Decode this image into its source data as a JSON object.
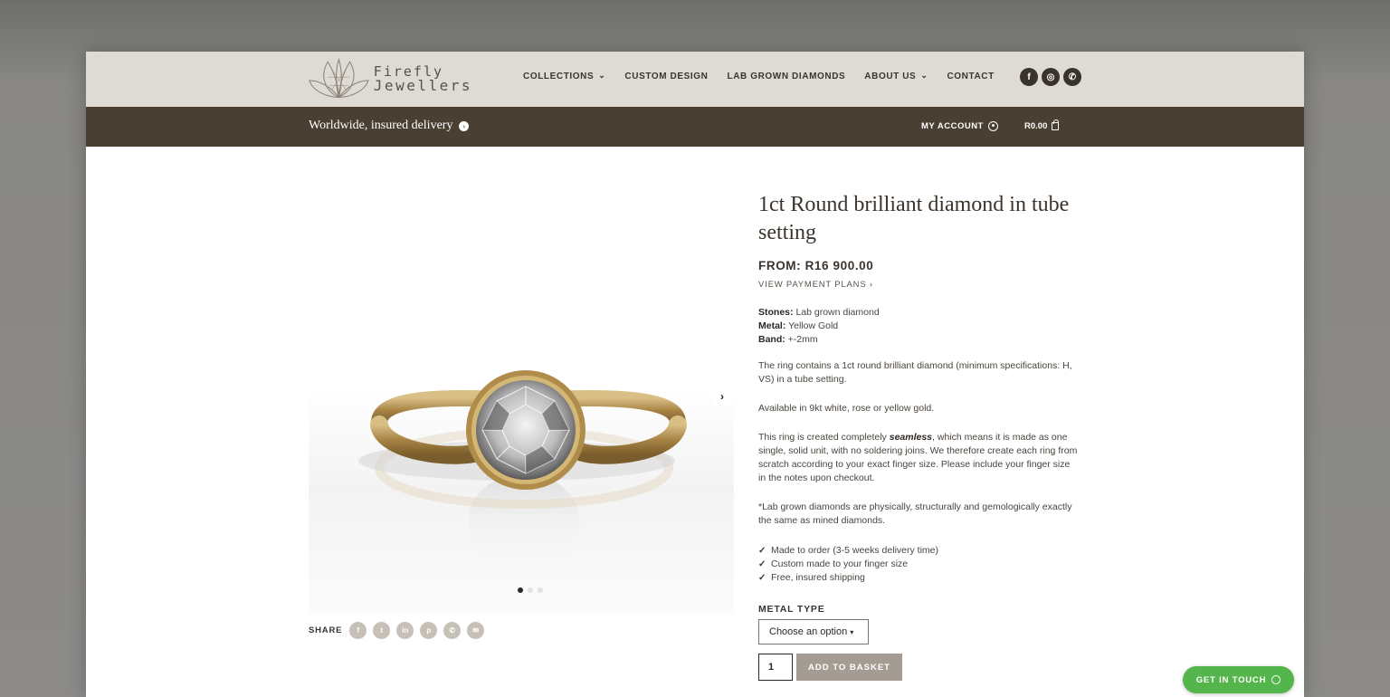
{
  "brand": {
    "logo_line1": "Firefly",
    "logo_line2": "Jewellers"
  },
  "nav": {
    "items": [
      {
        "label": "COLLECTIONS",
        "has_dropdown": true
      },
      {
        "label": "CUSTOM DESIGN",
        "has_dropdown": false
      },
      {
        "label": "LAB GROWN DIAMONDS",
        "has_dropdown": false
      },
      {
        "label": "ABOUT US",
        "has_dropdown": true
      },
      {
        "label": "CONTACT",
        "has_dropdown": false
      }
    ],
    "socials": [
      {
        "icon": "facebook-icon",
        "glyph": "f"
      },
      {
        "icon": "instagram-icon",
        "glyph": "◎"
      },
      {
        "icon": "whatsapp-icon",
        "glyph": "✆"
      }
    ]
  },
  "topbar": {
    "delivery": "Worldwide, insured delivery",
    "account": "MY ACCOUNT",
    "cart_total": "R0.00"
  },
  "product": {
    "title": "1ct Round brilliant diamond in tube setting",
    "price": "FROM: R16 900.00",
    "payment_plans": "VIEW PAYMENT PLANS ›",
    "specs": [
      {
        "label": "Stones:",
        "value": "Lab grown diamond"
      },
      {
        "label": "Metal:",
        "value": "Yellow Gold"
      },
      {
        "label": "Band:",
        "value": "+-2mm"
      }
    ],
    "description_1": "The ring contains a 1ct round brilliant diamond (minimum specifications: H, VS) in a tube setting.",
    "description_2": "Available in 9kt white, rose or yellow gold.",
    "description_3_before": "This ring is created completely ",
    "description_3_emph": "seamless",
    "description_3_after": ", which means it is made as one single, solid unit, with no soldering joins. We therefore create each ring from scratch according to your exact finger size. Please include your finger size in the notes upon checkout.",
    "description_4": "*Lab grown diamonds are physically, structurally and gemologically exactly the same as mined diamonds.",
    "features": [
      "Made to order (3-5 weeks delivery time)",
      "Custom made to your finger size",
      "Free, insured shipping"
    ],
    "metal_label": "METAL TYPE",
    "metal_select": "Choose an option",
    "quantity": "1",
    "add_to_basket": "ADD TO BASKET"
  },
  "gallery": {
    "share_label": "SHARE",
    "share_buttons": [
      "facebook-icon",
      "twitter-icon",
      "linkedin-icon",
      "pinterest-icon",
      "whatsapp-icon",
      "email-icon"
    ],
    "slide_count": 3,
    "active_slide": 1
  },
  "contact_widget": {
    "label": "GET IN TOUCH"
  },
  "colors": {
    "header_light": "#dedbd5",
    "header_dark": "#4a3f33",
    "accent_green": "#53b54b",
    "gold": "#b8954f"
  }
}
